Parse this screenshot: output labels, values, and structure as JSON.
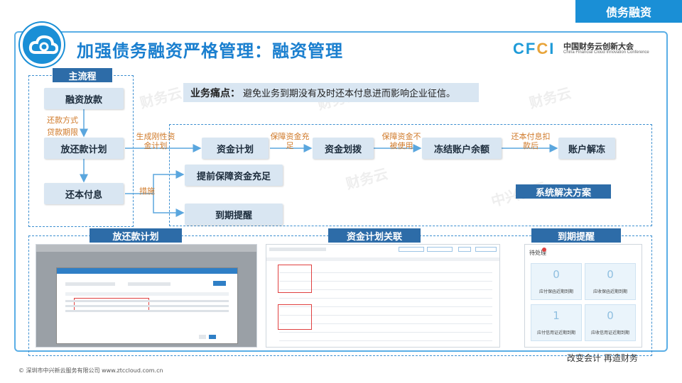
{
  "corner_tag": "债务融资",
  "title": "加强债务融资严格管理：融资管理",
  "brand": {
    "logo_text_c": "CF",
    "logo_text_accent": "C",
    "logo_text_i": "I",
    "name_cn": "中国财务云创新大会",
    "name_en": "China Financial Cloud Innovation Conference"
  },
  "main_flow": {
    "label": "主流程",
    "step1": "融资放款",
    "step2": "放还款计划",
    "step3": "还本付息",
    "note1": "还款方式",
    "note2": "贷款期限"
  },
  "pain_point": {
    "label": "业务痛点：",
    "text": "避免业务到期没有及时还本付息进而影响企业征信。"
  },
  "solution": {
    "label": "系统解决方案",
    "note_generate": "生成刚性资金计划",
    "box_capital_plan": "资金计划",
    "note_guarantee_fill": "保障资金充足",
    "box_allocation": "资金划拨",
    "note_guarantee_use": "保障资金不被使用",
    "box_freeze": "冻结账户余额",
    "note_repay": "还本付息扣款后",
    "box_unfreeze": "账户解冻",
    "note_measures": "措施",
    "box_early": "提前保障资金充足",
    "box_due": "到期提醒"
  },
  "bottom": {
    "label_plan": "放还款计划",
    "label_link": "资金计划关联",
    "label_remind": "到期提醒"
  },
  "todo": {
    "title": "待处理",
    "cards": [
      {
        "num": "0",
        "label": "应付保函近期到期"
      },
      {
        "num": "0",
        "label": "应收保函近期到期"
      },
      {
        "num": "1",
        "label": "应付信用证近期到期"
      },
      {
        "num": "0",
        "label": "应收信用证近期到期"
      }
    ]
  },
  "slogan": "改变会计  再造财务",
  "footer": "© 深圳市中兴新云服务有限公司   www.ztccloud.com.cn",
  "watermark": "财务云",
  "watermark2": "中兴新云",
  "colors": {
    "accent_blue": "#1a8fd6",
    "label_dark": "#2d6ca8",
    "box_bg": "#d9e6f2",
    "note_orange": "#d07a2a"
  }
}
